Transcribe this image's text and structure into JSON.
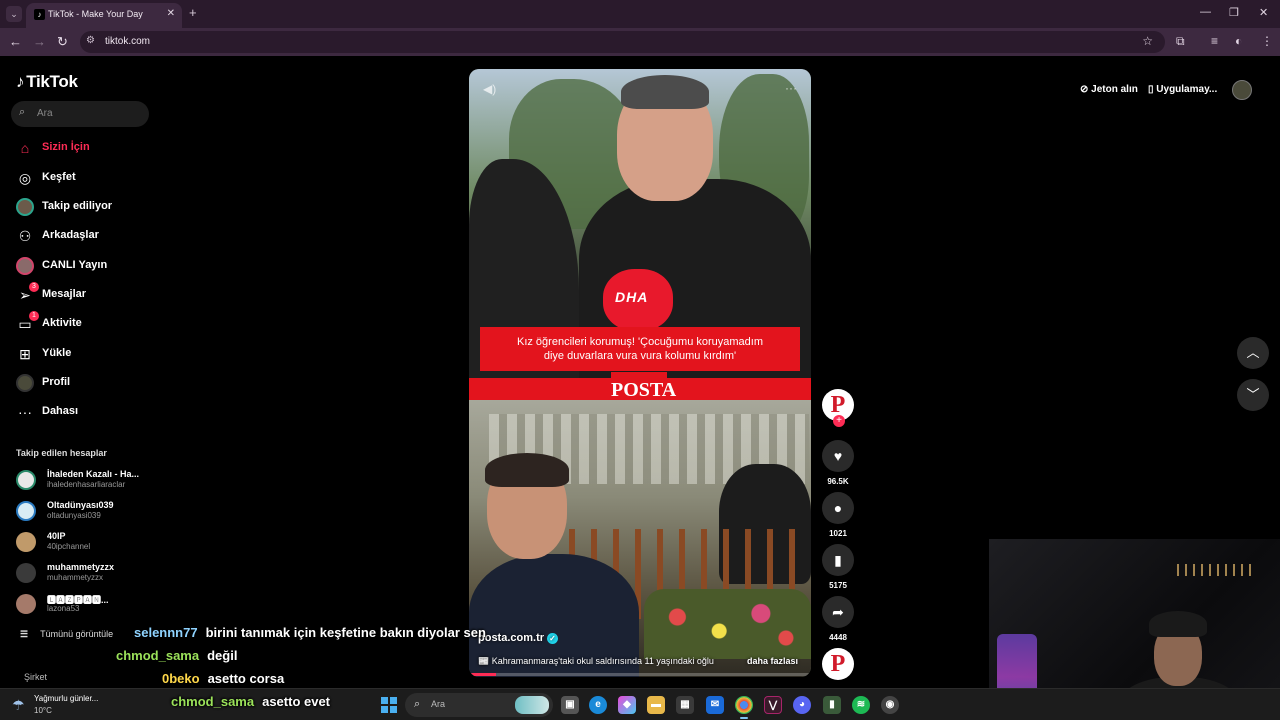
{
  "browser": {
    "tab_title": "TikTok - Make Your Day",
    "url": "tiktok.com"
  },
  "sidebar": {
    "logo": "TikTok",
    "search_placeholder": "Ara",
    "nav": [
      {
        "label": "Sizin İçin",
        "icon": "home-icon",
        "active": true
      },
      {
        "label": "Keşfet",
        "icon": "compass-icon"
      },
      {
        "label": "Takip ediliyor",
        "icon": "avatar"
      },
      {
        "label": "Arkadaşlar",
        "icon": "friends-icon"
      },
      {
        "label": "CANLI Yayın",
        "icon": "live-avatar"
      },
      {
        "label": "Mesajlar",
        "icon": "send-icon",
        "badge": "3"
      },
      {
        "label": "Aktivite",
        "icon": "activity-icon",
        "badge": "1"
      },
      {
        "label": "Yükle",
        "icon": "upload-icon"
      },
      {
        "label": "Profil",
        "icon": "profile-avatar"
      },
      {
        "label": "Dahası",
        "icon": "more-icon"
      }
    ],
    "following_title": "Takip edilen hesaplar",
    "following": [
      {
        "name": "İhaleden Kazalı - Ha...",
        "handle": "ihaledenhasarliaraclar"
      },
      {
        "name": "Oltadünyası039",
        "handle": "oltadunyasi039"
      },
      {
        "name": "40IP",
        "handle": "40ipchannel"
      },
      {
        "name": "muhammetyzzx",
        "handle": "muhammetyzzx"
      },
      {
        "name": "🅻🅰🆉🅿🅰🅽...",
        "handle": "lazona53"
      }
    ],
    "see_all": "Tümünü görüntüle",
    "company": "Şirket"
  },
  "header": {
    "coins": "Jeton alın",
    "get_app": "Uygulamay..."
  },
  "video": {
    "caption_line1": "Kız öğrencileri korumuş! 'Çocuğumu koruyamadım",
    "caption_line2": "diye duvarlara vura vura kolumu kırdım'",
    "mic_logo": "DHA",
    "brand": "POSTA",
    "author": "posta.com.tr",
    "description": "📰 Kahramanmaraş'taki okul saldırısında 11 yaşındaki oğlu",
    "see_more": "daha fazlası",
    "progress": 0.08
  },
  "actions": {
    "avatar_letter": "P",
    "likes": "96.5K",
    "comments": "1021",
    "saves": "5175",
    "shares": "4448"
  },
  "chat": [
    {
      "user": "selennn77",
      "message": "birini tanımak için keşfetine bakın diyolar sen",
      "color": "#8fd3ff"
    },
    {
      "user": "chmod_sama",
      "message": "değil",
      "color": "#9be25a"
    },
    {
      "user": "0beko",
      "message": "asetto corsa",
      "color": "#ffd84a"
    },
    {
      "user": "chmod_sama",
      "message": "asetto evet",
      "color": "#9be25a"
    }
  ],
  "taskbar": {
    "weather_text": "Yağmurlu günler...",
    "weather_temp": "10°C",
    "search_placeholder": "Ara"
  },
  "colors": {
    "accent": "#fe2c55",
    "posta_red": "#e3141d"
  }
}
